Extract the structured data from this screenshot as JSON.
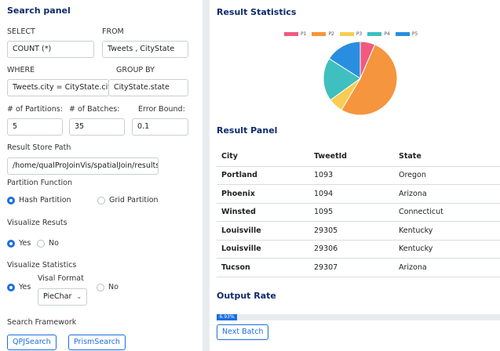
{
  "search_panel": {
    "title": "Search panel",
    "select_label": "SELECT",
    "select_value": "COUNT (*)",
    "from_label": "FROM",
    "from_value": "Tweets , CityState",
    "where_label": "WHERE",
    "where_value": "Tweets.city = CityState.city",
    "groupby_label": "GROUP BY",
    "groupby_value": "CityState.state",
    "partitions_label": "# of Partitions:",
    "partitions_value": "5",
    "batches_label": "# of Batches:",
    "batches_value": "35",
    "error_label": "Error Bound:",
    "error_value": "0.1",
    "store_path_label": "Result Store Path",
    "store_path_value": "/home/qualProJoinVis/spatialJoin/results/",
    "partition_function_label": "Partition Function",
    "hash_partition_label": "Hash Partition",
    "grid_partition_label": "Grid Partition",
    "visualize_results_label": "Visualize Resuts",
    "vr_yes": "Yes",
    "vr_no": "No",
    "visualize_statistics_label": "Visualize Statistics",
    "vs_yes": "Yes",
    "visal_format_label": "Visal Format",
    "visal_format_value": "PieChar",
    "vs_no": "No",
    "framework_label": "Search Framework",
    "qpj_button": "QPJSearch",
    "prism_button": "PrismSearch"
  },
  "result_statistics": {
    "title": "Result Statistics"
  },
  "chart_data": {
    "type": "pie",
    "legend_position": "top",
    "series": [
      {
        "name": "P1",
        "value": 6.5,
        "color": "#f05a7e"
      },
      {
        "name": "P2",
        "value": 52.0,
        "color": "#f5953d"
      },
      {
        "name": "P3",
        "value": 6.5,
        "color": "#f9cc54"
      },
      {
        "name": "P4",
        "value": 19.0,
        "color": "#3fbfbf"
      },
      {
        "name": "P5",
        "value": 16.0,
        "color": "#2a8ee0"
      }
    ]
  },
  "result_panel": {
    "title": "Result Panel",
    "columns": [
      "City",
      "TweetId",
      "State"
    ],
    "rows": [
      [
        "Portland",
        "1093",
        "Oregon"
      ],
      [
        "Phoenix",
        "1094",
        "Arizona"
      ],
      [
        "Winsted",
        "1095",
        "Connecticut"
      ],
      [
        "Louisville",
        "29305",
        "Kentucky"
      ],
      [
        "Louisville",
        "29306",
        "Kentucky"
      ],
      [
        "Tucson",
        "29307",
        "Arizona"
      ]
    ]
  },
  "output_rate": {
    "title": "Output Rate",
    "progress_percent": 6.93,
    "progress_text": "6.93%",
    "next_batch_button": "Next Batch"
  }
}
